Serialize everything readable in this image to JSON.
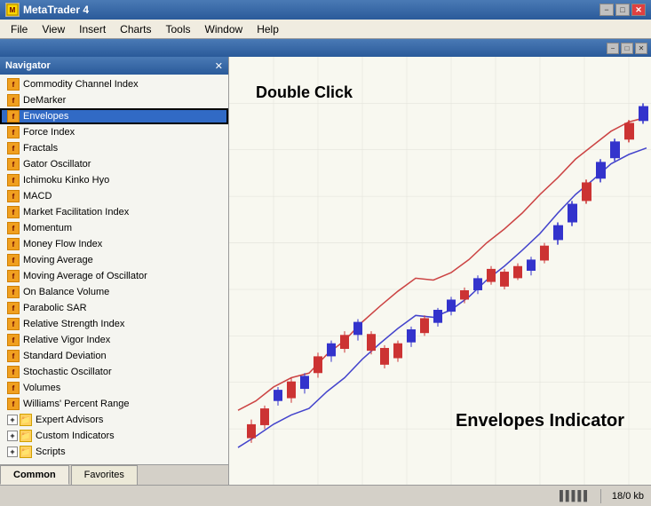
{
  "window": {
    "title": "MetaTrader 4",
    "minimize_label": "−",
    "maximize_label": "□",
    "close_label": "✕"
  },
  "menu": {
    "items": [
      "File",
      "View",
      "Insert",
      "Charts",
      "Tools",
      "Window",
      "Help"
    ]
  },
  "inner_window": {
    "title": "",
    "minimize_label": "−",
    "maximize_label": "□",
    "close_label": "✕"
  },
  "navigator": {
    "title": "Navigator",
    "close_label": "✕",
    "items": [
      {
        "label": "Commodity Channel Index",
        "type": "f"
      },
      {
        "label": "DeMarker",
        "type": "f"
      },
      {
        "label": "Envelopes",
        "type": "f",
        "selected": true
      },
      {
        "label": "Force Index",
        "type": "f"
      },
      {
        "label": "Fractals",
        "type": "f"
      },
      {
        "label": "Gator Oscillator",
        "type": "f"
      },
      {
        "label": "Ichimoku Kinko Hyo",
        "type": "f"
      },
      {
        "label": "MACD",
        "type": "f"
      },
      {
        "label": "Market Facilitation Index",
        "type": "f"
      },
      {
        "label": "Momentum",
        "type": "f"
      },
      {
        "label": "Money Flow Index",
        "type": "f"
      },
      {
        "label": "Moving Average",
        "type": "f"
      },
      {
        "label": "Moving Average of Oscillator",
        "type": "f"
      },
      {
        "label": "On Balance Volume",
        "type": "f"
      },
      {
        "label": "Parabolic SAR",
        "type": "f"
      },
      {
        "label": "Relative Strength Index",
        "type": "f"
      },
      {
        "label": "Relative Vigor Index",
        "type": "f"
      },
      {
        "label": "Standard Deviation",
        "type": "f"
      },
      {
        "label": "Stochastic Oscillator",
        "type": "f"
      },
      {
        "label": "Volumes",
        "type": "f"
      },
      {
        "label": "Williams' Percent Range",
        "type": "f"
      },
      {
        "label": "Expert Advisors",
        "type": "folder"
      },
      {
        "label": "Custom Indicators",
        "type": "folder"
      },
      {
        "label": "Scripts",
        "type": "folder"
      }
    ],
    "tabs": [
      {
        "label": "Common",
        "active": true
      },
      {
        "label": "Favorites",
        "active": false
      }
    ]
  },
  "chart": {
    "double_click_label": "Double Click",
    "envelopes_label": "Envelopes Indicator"
  },
  "statusbar": {
    "chart_icon": "▌▌▌▌▌",
    "kb_label": "18/0 kb"
  }
}
